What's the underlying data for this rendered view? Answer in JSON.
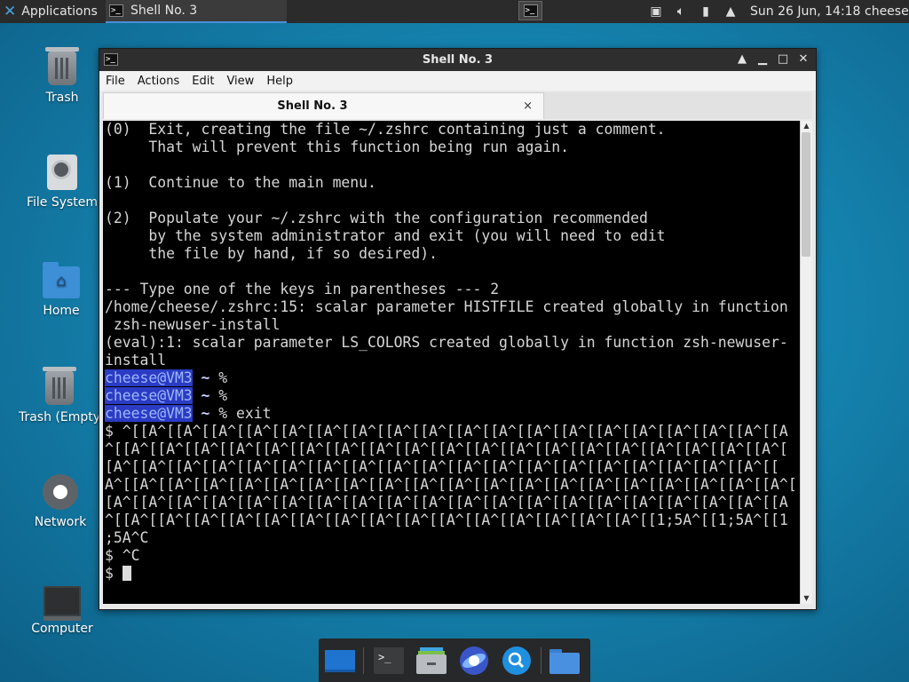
{
  "top_panel": {
    "applications_label": "Applications",
    "task_title": "Shell No. 3",
    "clock": "Sun 26 Jun, 14:18",
    "user": "cheese",
    "tray_icons": [
      "display-icon",
      "volume-icon",
      "battery-icon",
      "notification-bell-icon"
    ]
  },
  "desktop": {
    "icons": [
      {
        "label": "Trash",
        "icon": "trash-icon"
      },
      {
        "label": "File System",
        "icon": "drive-icon"
      },
      {
        "label": "Home",
        "icon": "home-folder-icon"
      },
      {
        "label": "Trash (Empty",
        "icon": "trash-icon"
      },
      {
        "label": "Network",
        "icon": "network-icon"
      },
      {
        "label": "Computer",
        "icon": "computer-icon"
      }
    ]
  },
  "window": {
    "title": "Shell No. 3",
    "menu": [
      "File",
      "Actions",
      "Edit",
      "View",
      "Help"
    ],
    "tab_title": "Shell No. 3",
    "tab_close": "×"
  },
  "terminal": {
    "lines": [
      {
        "text": "(0)  Exit, creating the file ~/.zshrc containing just a comment."
      },
      {
        "text": "     That will prevent this function being run again."
      },
      {
        "text": ""
      },
      {
        "text": "(1)  Continue to the main menu."
      },
      {
        "text": ""
      },
      {
        "text": "(2)  Populate your ~/.zshrc with the configuration recommended"
      },
      {
        "text": "     by the system administrator and exit (you will need to edit"
      },
      {
        "text": "     the file by hand, if so desired)."
      },
      {
        "text": ""
      },
      {
        "text": "--- Type one of the keys in parentheses --- 2"
      },
      {
        "text": "/home/cheese/.zshrc:15: scalar parameter HISTFILE created globally in function"
      },
      {
        "text": " zsh-newuser-install"
      },
      {
        "text": "(eval):1: scalar parameter LS_COLORS created globally in function zsh-newuser-"
      },
      {
        "text": "install"
      },
      {
        "prompt": "cheese@VM3",
        "tilde": " ~",
        "rest": " %"
      },
      {
        "prompt": "cheese@VM3",
        "tilde": " ~",
        "rest": " %"
      },
      {
        "prompt": "cheese@VM3",
        "tilde": " ~",
        "rest": " % exit"
      },
      {
        "text": "$ ^[[A^[[A^[[A^[[A^[[A^[[A^[[A^[[A^[[A^[[A^[[A^[[A^[[A^[[A^[[A^[[A^[[A^[[A^[[A"
      },
      {
        "text": "^[[A^[[A^[[A^[[A^[[A^[[A^[[A^[[A^[[A^[[A^[[A^[[A^[[A^[[A^[[A^[[A^[[A^[[A^[[A^["
      },
      {
        "text": "[A^[[A^[[A^[[A^[[A^[[A^[[A^[[A^[[A^[[A^[[A^[[A^[[A^[[A^[[A^[[A^[[A^[[A^[[A^[["
      },
      {
        "text": "A^[[A^[[A^[[A^[[A^[[A^[[A^[[A^[[A^[[A^[[A^[[A^[[A^[[A^[[A^[[A^[[A^[[A^[[A^[[A^["
      },
      {
        "text": "[A^[[A^[[A^[[A^[[A^[[A^[[A^[[A^[[A^[[A^[[A^[[A^[[A^[[A^[[A^[[A^[[A^[[A^[[A^[[A"
      },
      {
        "text": "^[[A^[[A^[[A^[[A^[[A^[[A^[[A^[[A^[[A^[[A^[[A^[[A^[[A^[[A^[[A^[[1;5A^[[1;5A^[[1"
      },
      {
        "text": ";5A^C"
      },
      {
        "text": "$ ^C"
      },
      {
        "text": "$ ",
        "cursor": true
      }
    ]
  },
  "dock": {
    "items": [
      "show-desktop-icon",
      "terminal-icon",
      "file-manager-icon",
      "web-browser-icon",
      "app-finder-icon",
      "folder-icon"
    ]
  },
  "colors": {
    "desktop": "#1584b0",
    "panel": "#2b2b2b",
    "prompt_highlight": "#2a3cc4",
    "accent": "#4a8fd8"
  }
}
